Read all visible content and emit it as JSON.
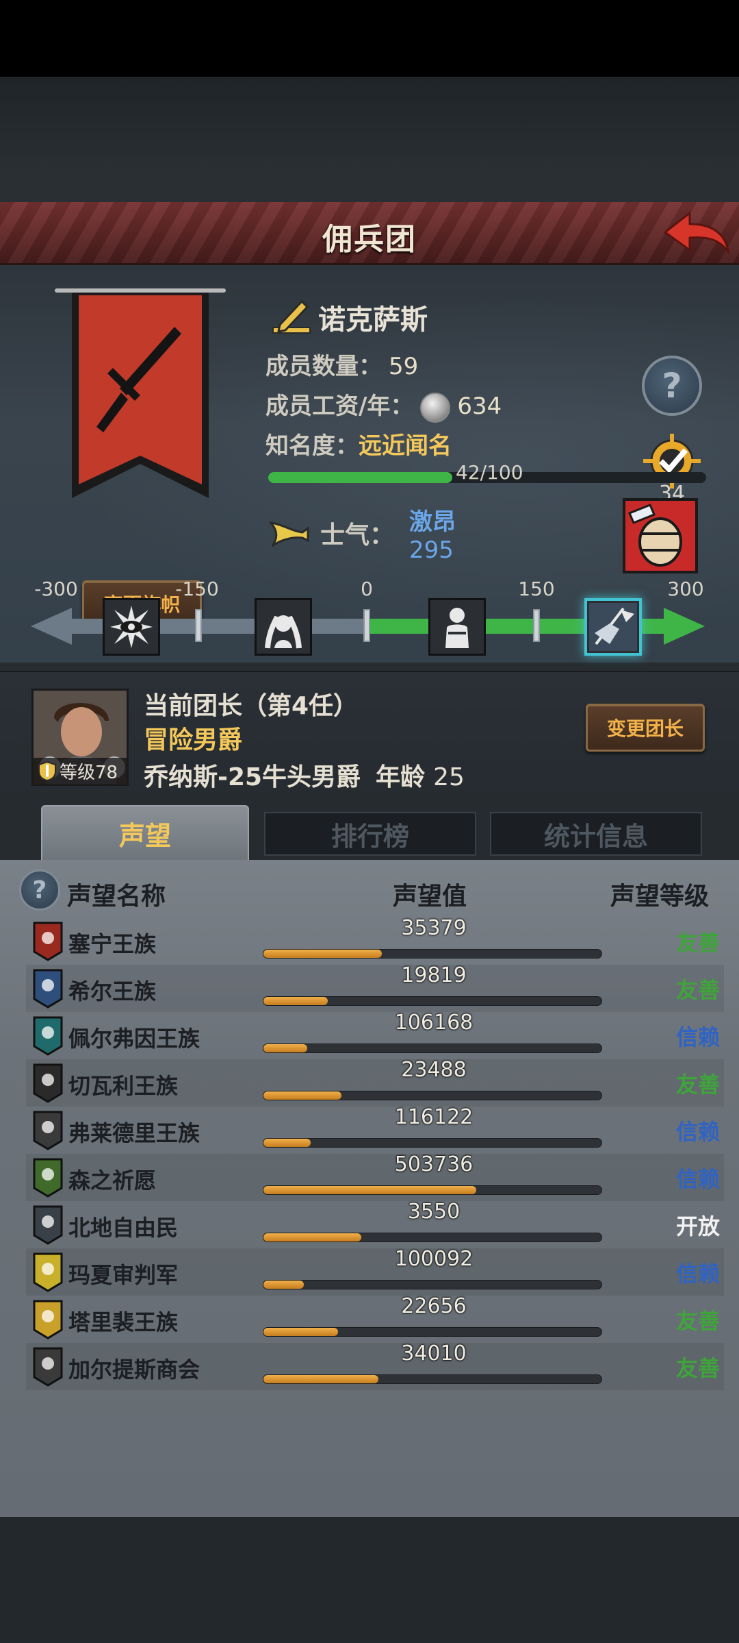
{
  "title": "佣兵团",
  "guild": {
    "name": "诺克萨斯",
    "members_label": "成员数量：",
    "members_value": "59",
    "salary_label": "成员工资/年：",
    "salary_value": "634",
    "fame_label": "知名度：",
    "fame_value": "远近闻名",
    "fame_progress": "42/100",
    "fame_fraction": 0.42,
    "target_count": "34",
    "change_flag_label": "变更旗帜",
    "help_symbol": "?"
  },
  "morale": {
    "label": "士气：",
    "state": "激昂",
    "value": "295",
    "ticks": [
      "-300",
      "-150",
      "0",
      "150",
      "300"
    ]
  },
  "leader": {
    "title": "当前团长（第4任）",
    "rank": "冒险男爵",
    "name": "乔纳斯-25牛头男爵",
    "age_label": "年龄",
    "age": "25",
    "level": "等级78",
    "change_leader_label": "变更团长"
  },
  "tabs": [
    {
      "label": "声望"
    },
    {
      "label": "排行榜"
    },
    {
      "label": "统计信息"
    }
  ],
  "reputation": {
    "headers": {
      "name": "声望名称",
      "value": "声望值",
      "level": "声望等级"
    },
    "help_symbol": "?",
    "rows": [
      {
        "name": "塞宁王族",
        "value": "35379",
        "fill": 0.35,
        "level": "友善",
        "level_color": "#3fa43a",
        "icon_color": "#9a2a20"
      },
      {
        "name": "希尔王族",
        "value": "19819",
        "fill": 0.19,
        "level": "友善",
        "level_color": "#3fa43a",
        "icon_color": "#2e4e7c"
      },
      {
        "name": "佩尔弗因王族",
        "value": "106168",
        "fill": 0.13,
        "level": "信赖",
        "level_color": "#2f63c4",
        "icon_color": "#1f6a6a"
      },
      {
        "name": "切瓦利王族",
        "value": "23488",
        "fill": 0.23,
        "level": "友善",
        "level_color": "#3fa43a",
        "icon_color": "#2a2a2a"
      },
      {
        "name": "弗莱德里王族",
        "value": "116122",
        "fill": 0.14,
        "level": "信赖",
        "level_color": "#2f63c4",
        "icon_color": "#3a3a3a"
      },
      {
        "name": "森之祈愿",
        "value": "503736",
        "fill": 0.63,
        "level": "信赖",
        "level_color": "#2f63c4",
        "icon_color": "#3f6a2a"
      },
      {
        "name": "北地自由民",
        "value": "3550",
        "fill": 0.29,
        "level": "开放",
        "level_color": "#f2f2f2",
        "icon_color": "#3a4048"
      },
      {
        "name": "玛夏审判军",
        "value": "100092",
        "fill": 0.12,
        "level": "信赖",
        "level_color": "#2f63c4",
        "icon_color": "#c9b02a"
      },
      {
        "name": "塔里裴王族",
        "value": "22656",
        "fill": 0.22,
        "level": "友善",
        "level_color": "#3fa43a",
        "icon_color": "#c9a02a"
      },
      {
        "name": "加尔提斯商会",
        "value": "34010",
        "fill": 0.34,
        "level": "友善",
        "level_color": "#3fa43a",
        "icon_color": "#3a3a3a"
      }
    ]
  }
}
